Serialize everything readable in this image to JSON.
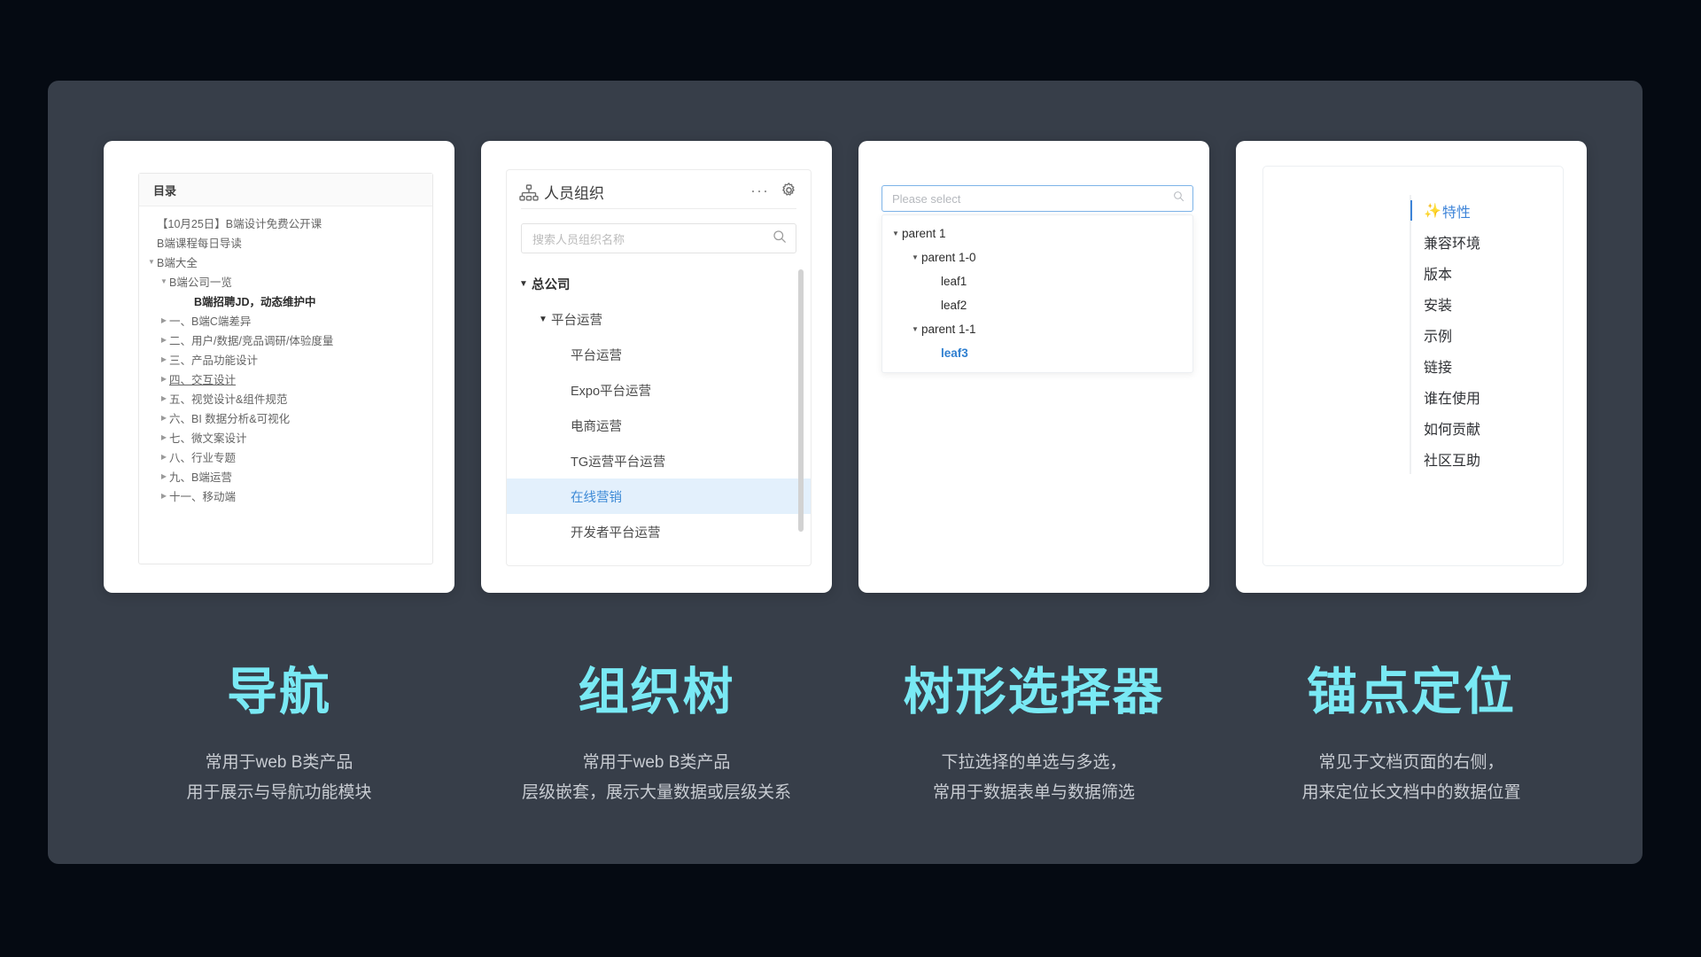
{
  "panels": [
    {
      "id": "nav",
      "header": "目录",
      "items": [
        {
          "label": "【10月25日】B端设计免费公开课",
          "indent": 1,
          "caret": "",
          "bold": false,
          "underline": false
        },
        {
          "label": "B端课程每日导读",
          "indent": 1,
          "caret": "",
          "bold": false,
          "underline": false
        },
        {
          "label": "B端大全",
          "indent": 1,
          "caret": "down",
          "bold": false,
          "underline": false
        },
        {
          "label": "B端公司一览",
          "indent": 2,
          "caret": "down",
          "bold": false,
          "underline": false
        },
        {
          "label": "B端招聘JD，动态维护中",
          "indent": 4,
          "caret": "",
          "bold": true,
          "underline": false
        },
        {
          "label": "一、B端C端差异",
          "indent": 2,
          "caret": "right",
          "bold": false,
          "underline": false
        },
        {
          "label": "二、用户/数据/竞品调研/体验度量",
          "indent": 2,
          "caret": "right",
          "bold": false,
          "underline": false
        },
        {
          "label": "三、产品功能设计",
          "indent": 2,
          "caret": "right",
          "bold": false,
          "underline": false
        },
        {
          "label": "四、交互设计",
          "indent": 2,
          "caret": "right",
          "bold": false,
          "underline": true
        },
        {
          "label": "五、视觉设计&组件规范",
          "indent": 2,
          "caret": "right",
          "bold": false,
          "underline": false
        },
        {
          "label": "六、BI 数据分析&可视化",
          "indent": 2,
          "caret": "right",
          "bold": false,
          "underline": false
        },
        {
          "label": "七、微文案设计",
          "indent": 2,
          "caret": "right",
          "bold": false,
          "underline": false
        },
        {
          "label": "八、行业专题",
          "indent": 2,
          "caret": "right",
          "bold": false,
          "underline": false
        },
        {
          "label": "九、B端运营",
          "indent": 2,
          "caret": "right",
          "bold": false,
          "underline": false
        },
        {
          "label": "十一、移动端",
          "indent": 2,
          "caret": "right",
          "bold": false,
          "underline": false
        }
      ]
    },
    {
      "id": "org",
      "title": "人员组织",
      "icon": "sitemap-icon",
      "more_label": "···",
      "search_placeholder": "搜索人员组织名称",
      "items": [
        {
          "label": "总公司",
          "indent": 1,
          "caret": "down",
          "strong": true,
          "selected": false
        },
        {
          "label": "平台运营",
          "indent": 2,
          "caret": "down",
          "strong": false,
          "selected": false
        },
        {
          "label": "平台运营",
          "indent": 3,
          "caret": "",
          "strong": false,
          "selected": false
        },
        {
          "label": "Expo平台运营",
          "indent": 3,
          "caret": "",
          "strong": false,
          "selected": false
        },
        {
          "label": "电商运营",
          "indent": 3,
          "caret": "",
          "strong": false,
          "selected": false
        },
        {
          "label": "TG运营平台运营",
          "indent": 3,
          "caret": "",
          "strong": false,
          "selected": false
        },
        {
          "label": "在线营销",
          "indent": 3,
          "caret": "",
          "strong": false,
          "selected": true
        },
        {
          "label": "开发者平台运营",
          "indent": 3,
          "caret": "",
          "strong": false,
          "selected": false
        }
      ]
    },
    {
      "id": "treeselect",
      "input_placeholder": "Please select",
      "items": [
        {
          "label": "parent 1",
          "indent": 1,
          "caret": "down",
          "selected": false
        },
        {
          "label": "parent 1-0",
          "indent": 2,
          "caret": "down",
          "selected": false
        },
        {
          "label": "leaf1",
          "indent": 3,
          "caret": "",
          "selected": false
        },
        {
          "label": "leaf2",
          "indent": 3,
          "caret": "",
          "selected": false
        },
        {
          "label": "parent 1-1",
          "indent": 2,
          "caret": "down",
          "selected": false
        },
        {
          "label": "leaf3",
          "indent": 3,
          "caret": "",
          "selected": true
        }
      ]
    },
    {
      "id": "anchor",
      "items": [
        {
          "label": "特性",
          "spark": "✨",
          "active": true
        },
        {
          "label": "兼容环境",
          "spark": "",
          "active": false
        },
        {
          "label": "版本",
          "spark": "",
          "active": false
        },
        {
          "label": "安装",
          "spark": "",
          "active": false
        },
        {
          "label": "示例",
          "spark": "",
          "active": false
        },
        {
          "label": "链接",
          "spark": "",
          "active": false
        },
        {
          "label": "谁在使用",
          "spark": "",
          "active": false
        },
        {
          "label": "如何贡献",
          "spark": "",
          "active": false
        },
        {
          "label": "社区互助",
          "spark": "",
          "active": false
        }
      ]
    }
  ],
  "captions": [
    {
      "title": "导航",
      "line1": "常用于web B类产品",
      "line2": "用于展示与导航功能模块"
    },
    {
      "title": "组织树",
      "line1": "常用于web B类产品",
      "line2": "层级嵌套，展示大量数据或层级关系"
    },
    {
      "title": "树形选择器",
      "line1": "下拉选择的单选与多选，",
      "line2": "常用于数据表单与数据筛选"
    },
    {
      "title": "锚点定位",
      "line1": "常见于文档页面的右侧，",
      "line2": "用来定位长文档中的数据位置"
    }
  ],
  "colors": {
    "page_background": "#050a12",
    "stage_background": "#373e49",
    "card_background": "#ffffff",
    "accent_cyan": "#79e9f4",
    "accent_blue": "#3e84d8",
    "selected_row_background": "#e3f0fc",
    "caption_text": "#c8ccd2"
  }
}
